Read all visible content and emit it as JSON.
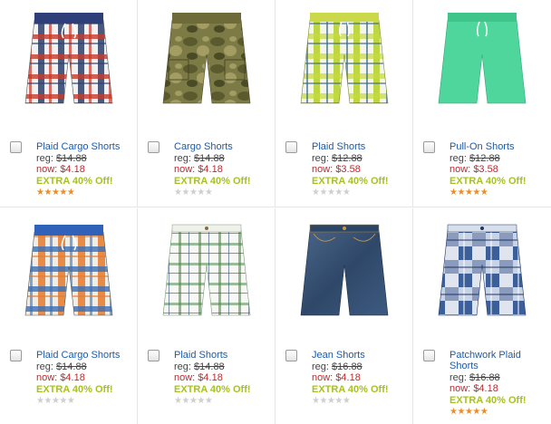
{
  "products": [
    {
      "name": "Plaid Cargo Shorts",
      "reg_label": "reg:",
      "reg_price": "$14.88",
      "now_label": "now:",
      "now_price": "$4.18",
      "promo": "EXTRA 40% Off!",
      "rating": 5,
      "image_icon": "plaid-cargo-shorts-image"
    },
    {
      "name": "Cargo Shorts",
      "reg_label": "reg:",
      "reg_price": "$14.88",
      "now_label": "now:",
      "now_price": "$4.18",
      "promo": "EXTRA 40% Off!",
      "rating": 0,
      "image_icon": "camo-cargo-shorts-image"
    },
    {
      "name": "Plaid Shorts",
      "reg_label": "reg:",
      "reg_price": "$12.88",
      "now_label": "now:",
      "now_price": "$3.58",
      "promo": "EXTRA 40% Off!",
      "rating": 0,
      "image_icon": "green-plaid-shorts-image"
    },
    {
      "name": "Pull-On Shorts",
      "reg_label": "reg:",
      "reg_price": "$12.88",
      "now_label": "now:",
      "now_price": "$3.58",
      "promo": "EXTRA 40% Off!",
      "rating": 5,
      "image_icon": "mint-pull-on-shorts-image"
    },
    {
      "name": "Plaid Cargo Shorts",
      "reg_label": "reg:",
      "reg_price": "$14.88",
      "now_label": "now:",
      "now_price": "$4.18",
      "promo": "EXTRA 40% Off!",
      "rating": 0,
      "image_icon": "orange-plaid-cargo-shorts-image"
    },
    {
      "name": "Plaid Shorts",
      "reg_label": "reg:",
      "reg_price": "$14.88",
      "now_label": "now:",
      "now_price": "$4.18",
      "promo": "EXTRA 40% Off!",
      "rating": 0,
      "image_icon": "white-plaid-shorts-image"
    },
    {
      "name": "Jean Shorts",
      "reg_label": "reg:",
      "reg_price": "$16.88",
      "now_label": "now:",
      "now_price": "$4.18",
      "promo": "EXTRA 40% Off!",
      "rating": 0,
      "image_icon": "jean-shorts-image"
    },
    {
      "name": "Patchwork Plaid Shorts",
      "reg_label": "reg:",
      "reg_price": "$16.88",
      "now_label": "now:",
      "now_price": "$4.18",
      "promo": "EXTRA 40% Off!",
      "rating": 5,
      "image_icon": "patchwork-plaid-shorts-image"
    }
  ],
  "colors": {
    "link": "#1d5aa8",
    "sale": "#c0272d",
    "promo": "#a8c124",
    "star_on": "#f48b1f",
    "star_off": "#cfcfcf"
  }
}
